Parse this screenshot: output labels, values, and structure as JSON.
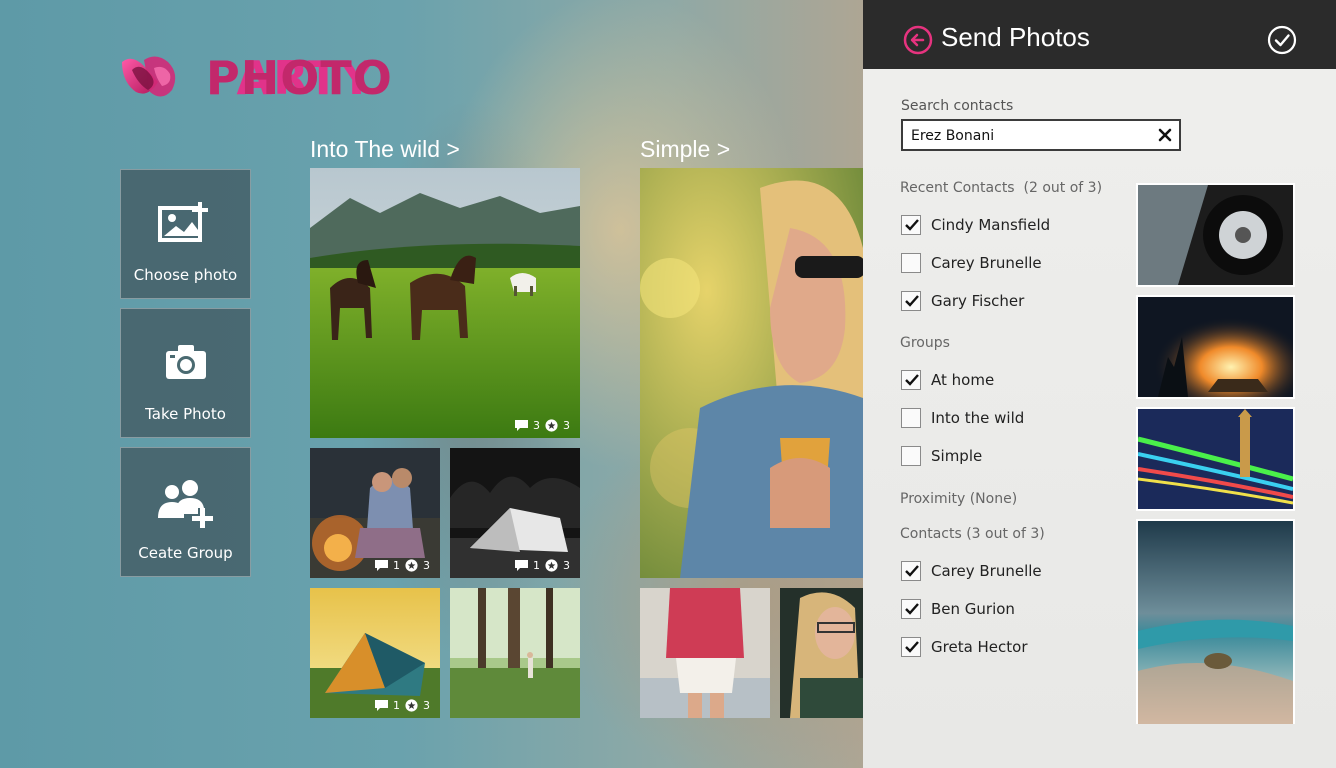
{
  "logo": {
    "part1": "PHOTO",
    "part2": "PARTY"
  },
  "tiles": [
    {
      "label": "Choose photo",
      "icon": "image-add-icon"
    },
    {
      "label": "Take Photo",
      "icon": "camera-icon"
    },
    {
      "label": "Ceate Group",
      "icon": "add-group-icon"
    }
  ],
  "sections": [
    {
      "title": "Into The wild >"
    },
    {
      "title": "Simple >"
    }
  ],
  "photo_badges": {
    "horses": {
      "comments": "3",
      "stars": "3"
    },
    "couple": {
      "comments": "1",
      "stars": "3"
    },
    "night_tent": {
      "comments": "1",
      "stars": "3"
    },
    "green_tent": {
      "comments": "1",
      "stars": "3"
    }
  },
  "panel": {
    "title": "Send Photos",
    "search": {
      "label": "Search contacts",
      "value": "Erez Bonani"
    },
    "recent": {
      "label": "Recent Contacts",
      "count": "(2 out of 3)",
      "items": [
        {
          "name": "Cindy Mansfield",
          "checked": true
        },
        {
          "name": "Carey Brunelle",
          "checked": false
        },
        {
          "name": "Gary Fischer",
          "checked": true
        }
      ]
    },
    "groups": {
      "label": "Groups",
      "items": [
        {
          "name": "At home",
          "checked": true
        },
        {
          "name": "Into the wild",
          "checked": false
        },
        {
          "name": "Simple",
          "checked": false
        }
      ]
    },
    "proximity": {
      "label": "Proximity (None)"
    },
    "contacts": {
      "label": "Contacts (3 out of 3)",
      "items": [
        {
          "name": "Carey Brunelle",
          "checked": true
        },
        {
          "name": "Ben Gurion",
          "checked": true
        },
        {
          "name": "Greta Hector",
          "checked": true
        }
      ]
    }
  },
  "colors": {
    "brand_pink": "#e1338a",
    "header_bg": "#2b2b2b",
    "back_button": "#e6337f"
  }
}
